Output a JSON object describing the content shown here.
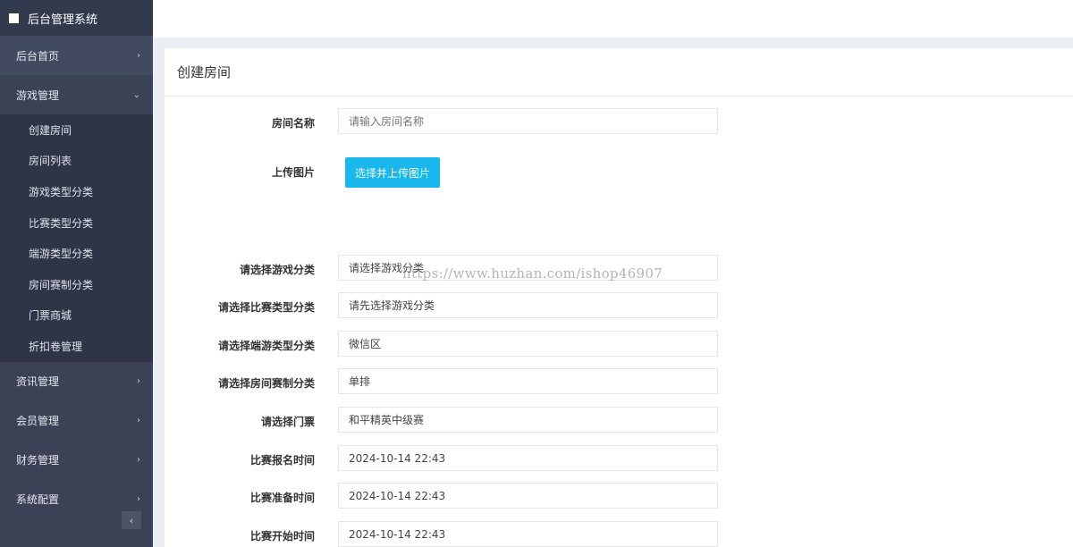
{
  "sidebar": {
    "brand": "后台管理系统",
    "items": [
      {
        "label": "后台首页",
        "chevron": "›"
      },
      {
        "label": "游戏管理",
        "chevron": "⌄"
      }
    ],
    "submenu": [
      {
        "label": "创建房间"
      },
      {
        "label": "房间列表"
      },
      {
        "label": "游戏类型分类"
      },
      {
        "label": "比赛类型分类"
      },
      {
        "label": "端游类型分类"
      },
      {
        "label": "房间赛制分类"
      },
      {
        "label": "门票商城"
      },
      {
        "label": "折扣卷管理"
      }
    ],
    "lower_items": [
      {
        "label": "资讯管理",
        "chevron": "›"
      },
      {
        "label": "会员管理",
        "chevron": "›"
      },
      {
        "label": "财务管理",
        "chevron": "›"
      },
      {
        "label": "系统配置",
        "chevron": "›"
      }
    ],
    "collapse": "‹"
  },
  "panel": {
    "title": "创建房间"
  },
  "form": {
    "room_name_label": "房间名称",
    "room_name_placeholder": "请输入房间名称",
    "upload_label": "上传图片",
    "upload_button": "选择并上传图片",
    "game_cat_label": "请选择游戏分类",
    "game_cat_value": "请选择游戏分类",
    "match_type_label": "请选择比赛类型分类",
    "match_type_value": "请先选择游戏分类",
    "client_type_label": "请选择端游类型分类",
    "client_type_value": "微信区",
    "format_label": "请选择房间赛制分类",
    "format_value": "单排",
    "ticket_label": "请选择门票",
    "ticket_value": "和平精英中级赛",
    "signup_label": "比赛报名时间",
    "signup_value": "2024-10-14 22:43",
    "prepare_label": "比赛准备时间",
    "prepare_value": "2024-10-14 22:43",
    "start_label": "比赛开始时间",
    "start_value": "2024-10-14 22:43"
  },
  "watermark": "https://www.huzhan.com/ishop46907",
  "colors": {
    "sidebar": "#3b4256",
    "submenu": "#2f3547",
    "accent": "#19b7ec",
    "background": "#ebeef2"
  }
}
